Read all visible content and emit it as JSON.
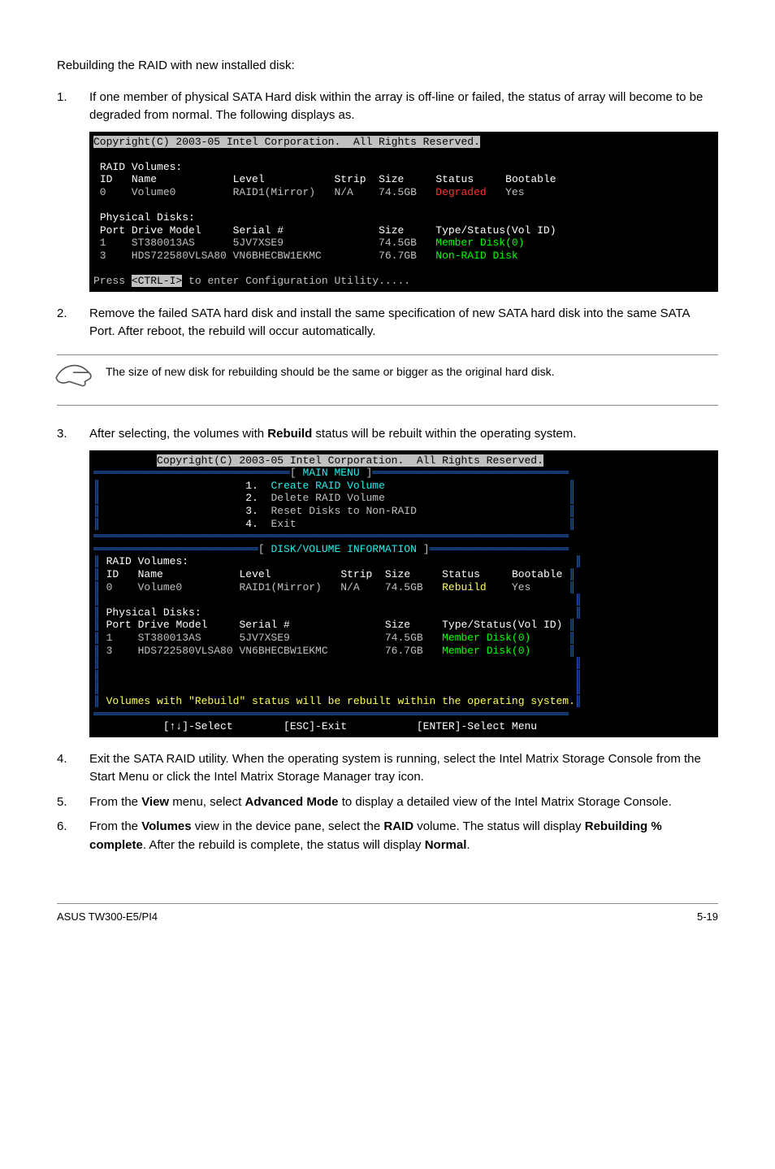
{
  "intro": "Rebuilding the RAID with new installed disk:",
  "step1": {
    "num": "1.",
    "text": "If one member of physical SATA Hard disk within the array is off-line or failed, the status of array will become to be degraded from normal. The following displays as."
  },
  "step2": {
    "num": "2.",
    "text": "Remove the failed SATA hard disk and install the same specification of new SATA hard disk into the same SATA Port. After reboot, the rebuild will occur automatically."
  },
  "note": "The size of new disk for rebuilding should be the same or bigger as the original hard disk.",
  "step3": {
    "num": "3.",
    "pre": "After selecting, the volumes with ",
    "bold": "Rebuild",
    "post": " status will be rebuilt within the operating system."
  },
  "step4": {
    "num": "4.",
    "text": "Exit the SATA RAID utility. When the operating system is running, select the Intel Matrix Storage Console from the Start Menu or click the Intel Matrix Storage Manager tray icon."
  },
  "step5": {
    "num": "5.",
    "pre": "From the ",
    "b1": "View",
    "mid": " menu, select ",
    "b2": "Advanced Mode",
    "post": " to display a detailed view of the Intel Matrix Storage Console."
  },
  "step6": {
    "num": "6.",
    "pre": "From the ",
    "b1": "Volumes",
    "m1": " view in the device pane, select the ",
    "b2": "RAID",
    "m2": " volume. The status will display ",
    "b3": "Rebuilding % complete",
    "m3": ". After the rebuild is complete, the status will display ",
    "b4": "Normal",
    "post": "."
  },
  "footer": {
    "left": "ASUS TW300-E5/PI4",
    "right": "5-19"
  },
  "chart_data": [
    {
      "type": "table",
      "title": "BIOS screenshot 1 (Intel RAID status)",
      "header_line": "Copyright(C) 2003-05 Intel Corporation.  All Rights Reserved.",
      "sections": {
        "RAID Volumes": {
          "columns": [
            "ID",
            "Name",
            "Level",
            "Strip",
            "Size",
            "Status",
            "Bootable"
          ],
          "rows": [
            [
              "0",
              "Volume0",
              "RAID1(Mirror)",
              "N/A",
              "74.5GB",
              "Degraded",
              "Yes"
            ]
          ]
        },
        "Physical Disks": {
          "columns": [
            "Port",
            "Drive Model",
            "Serial #",
            "Size",
            "Type/Status(Vol ID)"
          ],
          "rows": [
            [
              "1",
              "ST380013AS",
              "5JV7XSE9",
              "74.5GB",
              "Member Disk(0)"
            ],
            [
              "3",
              "HDS722580VLSA80",
              "VN6BHECBW1EKMC",
              "76.7GB",
              "Non-RAID Disk"
            ]
          ]
        }
      },
      "footer_line": "Press <CTRL-I> to enter Configuration Utility....."
    },
    {
      "type": "table",
      "title": "BIOS screenshot 2 (Intel RAID main menu + disk/volume info)",
      "header_line": "Copyright(C) 2003-05 Intel Corporation.  All Rights Reserved.",
      "main_menu": {
        "title": "MAIN MENU",
        "items": [
          {
            "n": "1.",
            "label": "Create RAID Volume"
          },
          {
            "n": "2.",
            "label": "Delete RAID Volume"
          },
          {
            "n": "3.",
            "label": "Reset Disks to Non-RAID"
          },
          {
            "n": "4.",
            "label": "Exit"
          }
        ]
      },
      "section_title": "DISK/VOLUME INFORMATION",
      "sections": {
        "RAID Volumes": {
          "columns": [
            "ID",
            "Name",
            "Level",
            "Strip",
            "Size",
            "Status",
            "Bootable"
          ],
          "rows": [
            [
              "0",
              "Volume0",
              "RAID1(Mirror)",
              "N/A",
              "74.5GB",
              "Rebuild",
              "Yes"
            ]
          ]
        },
        "Physical Disks": {
          "columns": [
            "Port",
            "Drive Model",
            "Serial #",
            "Size",
            "Type/Status(Vol ID)"
          ],
          "rows": [
            [
              "1",
              "ST380013AS",
              "5JV7XSE9",
              "74.5GB",
              "Member Disk(0)"
            ],
            [
              "3",
              "HDS722580VLSA80",
              "VN6BHECBW1EKMC",
              "76.7GB",
              "Member Disk(0)"
            ]
          ]
        }
      },
      "hint": "Volumes with \"Rebuild\" status will be rebuilt within the operating system.",
      "nav_bar": "[↑↓]-Select        [ESC]-Exit           [ENTER]-Select Menu"
    }
  ]
}
